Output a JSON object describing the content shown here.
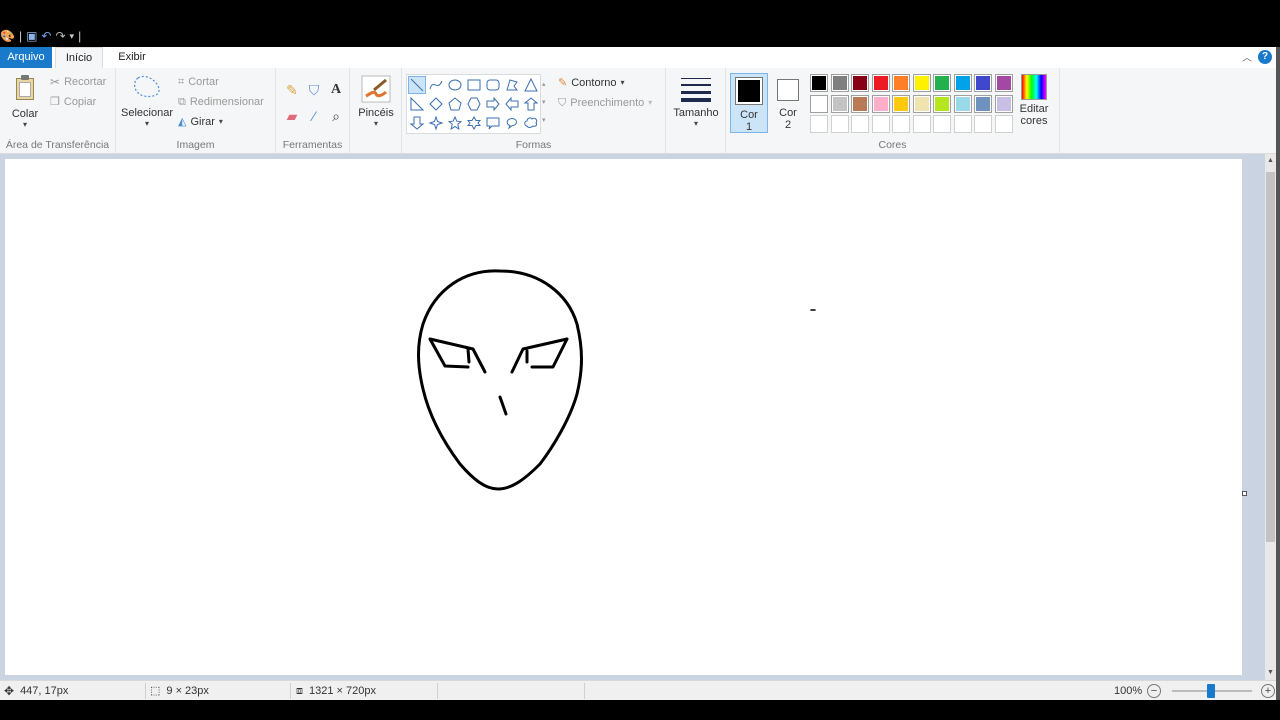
{
  "tabs": {
    "file": "Arquivo",
    "home": "Início",
    "view": "Exibir"
  },
  "clipboard": {
    "paste": "Colar",
    "cut": "Recortar",
    "copy": "Copiar",
    "group": "Área de Transferência"
  },
  "image": {
    "select": "Selecionar",
    "crop": "Cortar",
    "resize": "Redimensionar",
    "rotate": "Girar",
    "group": "Imagem"
  },
  "tools": {
    "group": "Ferramentas",
    "brushes": "Pincéis"
  },
  "shapes": {
    "outline": "Contorno",
    "fill": "Preenchimento",
    "group": "Formas"
  },
  "size": {
    "label": "Tamanho"
  },
  "colors": {
    "color1_label": "Cor",
    "color1_num": "1",
    "color2_label": "Cor",
    "color2_num": "2",
    "color1": "#000000",
    "color2": "#ffffff",
    "edit_line1": "Editar",
    "edit_line2": "cores",
    "group": "Cores",
    "row1": [
      "#000000",
      "#7f7f7f",
      "#880015",
      "#ed1c24",
      "#ff7f27",
      "#fff200",
      "#22b14c",
      "#00a2e8",
      "#3f48cc",
      "#a349a4"
    ],
    "row2": [
      "#ffffff",
      "#c3c3c3",
      "#b97a57",
      "#ffaec9",
      "#ffc90e",
      "#efe4b0",
      "#b5e61d",
      "#99d9ea",
      "#7092be",
      "#c8bfe7"
    ]
  },
  "status": {
    "cursor_pos": "447, 17px",
    "selection_size": "9 × 23px",
    "image_size": "1321 × 720px",
    "zoom": "100%"
  }
}
